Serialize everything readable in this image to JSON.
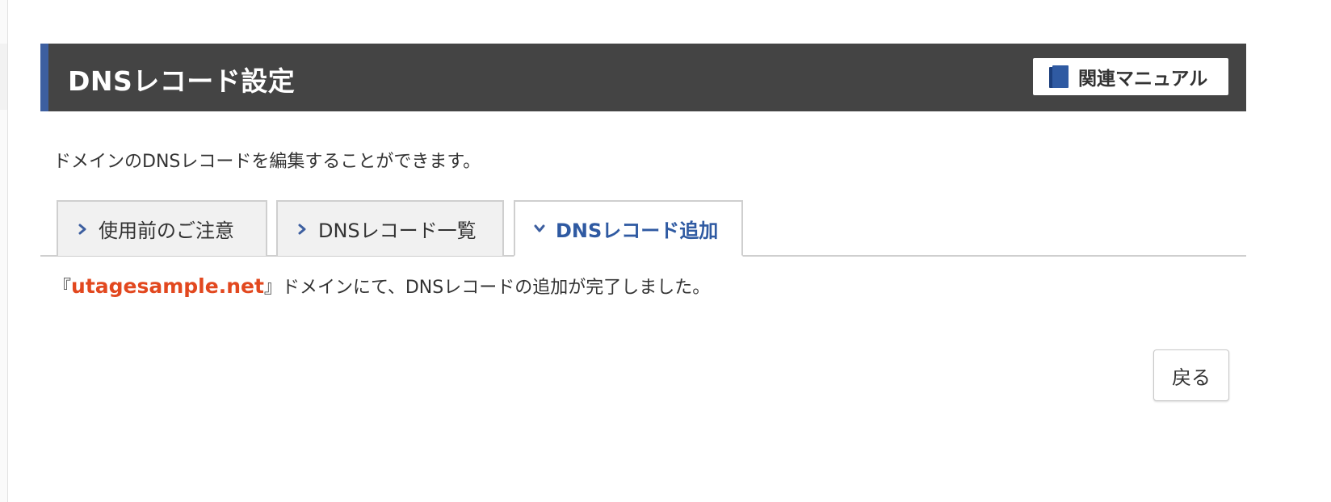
{
  "header": {
    "title": "DNSレコード設定",
    "manual_button_label": "関連マニュアル"
  },
  "description": "ドメインのDNSレコードを編集することができます。",
  "tabs": [
    {
      "label": "使用前のご注意",
      "active": false
    },
    {
      "label": "DNSレコード一覧",
      "active": false
    },
    {
      "label": "DNSレコード追加",
      "active": true
    }
  ],
  "result": {
    "open_bracket": "『",
    "domain": "utagesample.net",
    "close_bracket": "』",
    "message": "ドメインにて、DNSレコードの追加が完了しました。"
  },
  "back_button_label": "戻る",
  "colors": {
    "header_bg": "#444444",
    "header_accent": "#3d5fa0",
    "active_tab_text": "#2f5aa2",
    "domain_highlight": "#e2481f"
  },
  "icons": {
    "manual": "book-icon",
    "tab_inactive": "chevron-right-icon",
    "tab_active": "chevron-down-icon"
  }
}
